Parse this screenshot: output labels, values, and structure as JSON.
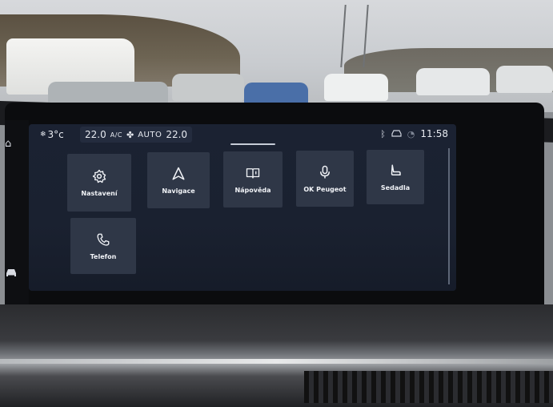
{
  "status_bar": {
    "outside_temp": "3°c",
    "climate": {
      "temp_left": "22.0",
      "ac_label": "A/C",
      "auto_label": "AUTO",
      "temp_right": "22.0"
    },
    "icons": [
      "bluetooth-icon",
      "connected-car-icon",
      "signal-icon"
    ],
    "time": "11:58"
  },
  "apps": [
    {
      "label": "Nastavení",
      "icon": "gear-icon"
    },
    {
      "label": "Navigace",
      "icon": "navigation-arrow-icon"
    },
    {
      "label": "Nápověda",
      "icon": "book-icon"
    },
    {
      "label": "OK Peugeot",
      "icon": "microphone-icon"
    },
    {
      "label": "Sedadla",
      "icon": "seat-icon"
    },
    {
      "label": "Telefon",
      "icon": "phone-icon"
    }
  ],
  "colors": {
    "screen_bg": "#1b2232",
    "tile_bg": "#2f3747",
    "text": "#f1f3f7"
  }
}
